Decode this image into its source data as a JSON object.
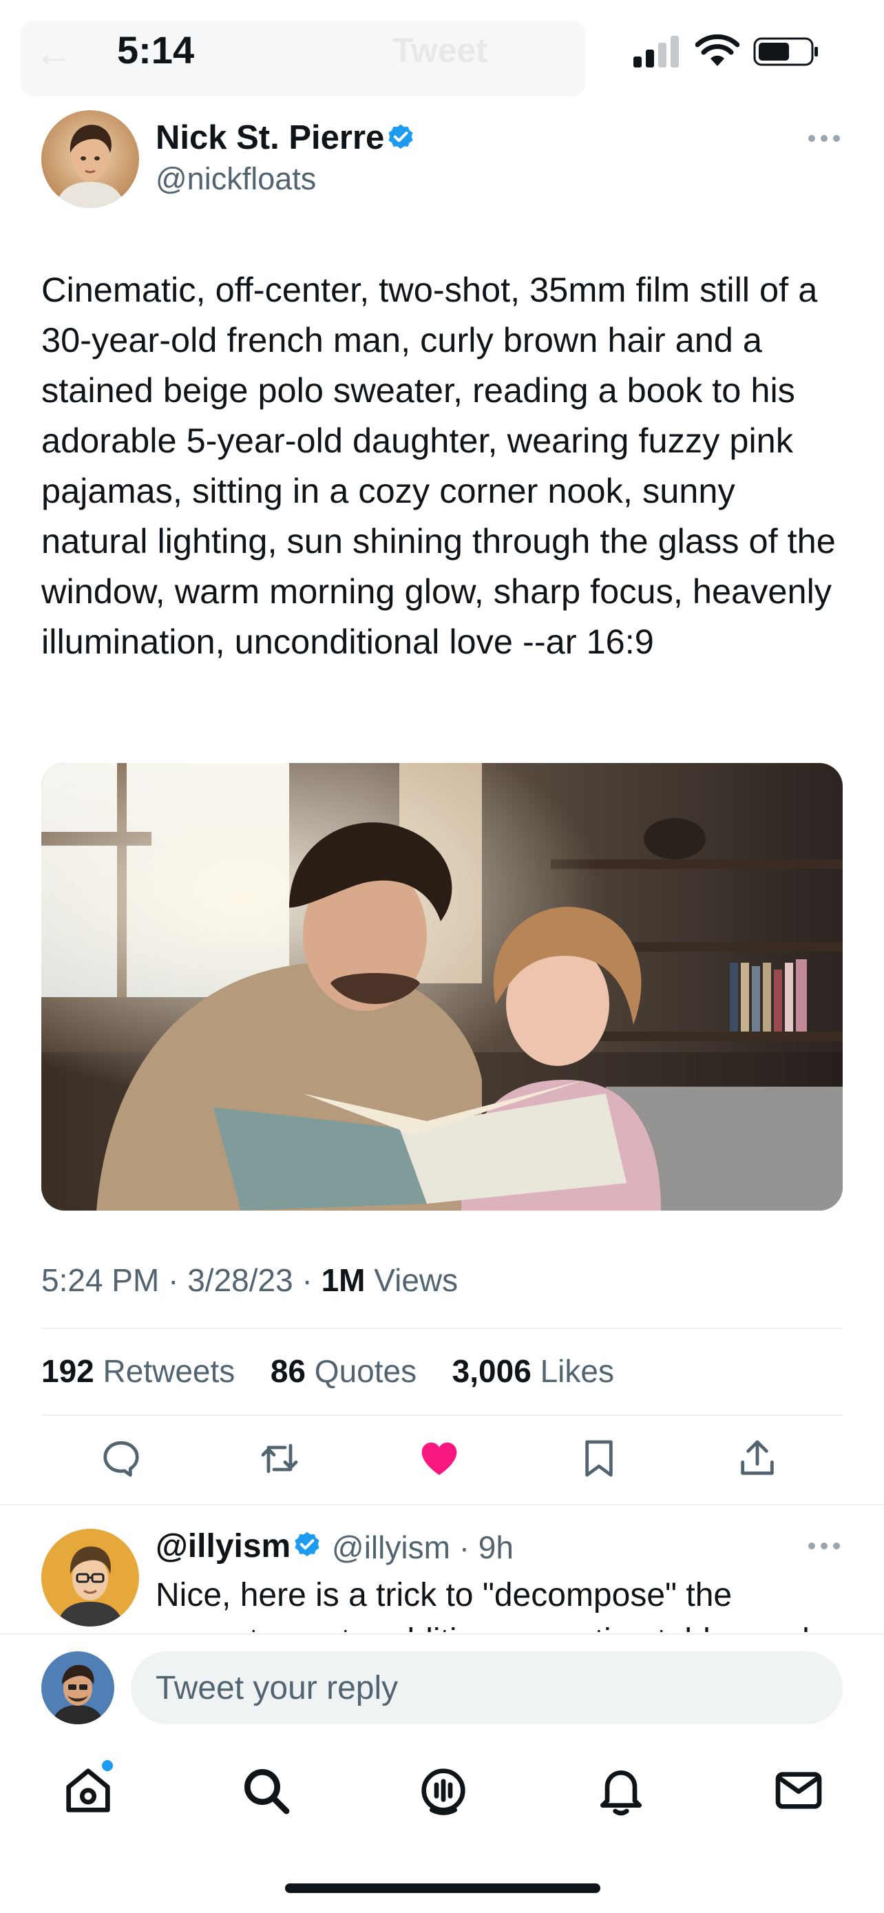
{
  "status_bar": {
    "time": "5:14",
    "nav_ghost_title": "Tweet",
    "icons": [
      "cellular-signal-icon",
      "wifi-icon",
      "battery-icon"
    ]
  },
  "tweet": {
    "author": {
      "name": "Nick St. Pierre",
      "handle": "@nickfloats",
      "verified": true
    },
    "text": "Cinematic, off-center, two-shot, 35mm film still of a 30-year-old french man, curly brown hair and a stained beige polo sweater, reading a book to his adorable 5-year-old daughter, wearing fuzzy pink pajamas, sitting in a cozy corner nook, sunny natural lighting, sun shining through the glass of the window, warm morning glow, sharp focus, heavenly illumination, unconditional love --ar 16:9",
    "meta": {
      "time": "5:24 PM",
      "date": "3/28/23",
      "views_count": "1M",
      "views_label": "Views",
      "separator": "·"
    },
    "stats": {
      "retweets_count": "192",
      "retweets_label": "Retweets",
      "quotes_count": "86",
      "quotes_label": "Quotes",
      "likes_count": "3,006",
      "likes_label": "Likes"
    },
    "actions": [
      "reply-icon",
      "retweet-icon",
      "like-icon",
      "bookmark-icon",
      "share-icon"
    ],
    "liked": true
  },
  "reply": {
    "name": "@illyism",
    "handle": "@illyism",
    "age": "9h",
    "verified": true,
    "text": "Nice, here is a trick to \"decompose\" the prompt, create additive prompting tables and"
  },
  "composer": {
    "placeholder": "Tweet your reply"
  },
  "tab_bar": {
    "tabs": [
      "home-icon",
      "search-icon",
      "spaces-icon",
      "notifications-icon",
      "messages-icon"
    ],
    "home_has_badge": true
  },
  "colors": {
    "text": "#0f1419",
    "secondary": "#536471",
    "verified": "#1d9bf0",
    "like": "#f91880",
    "divider": "#eff3f4"
  }
}
